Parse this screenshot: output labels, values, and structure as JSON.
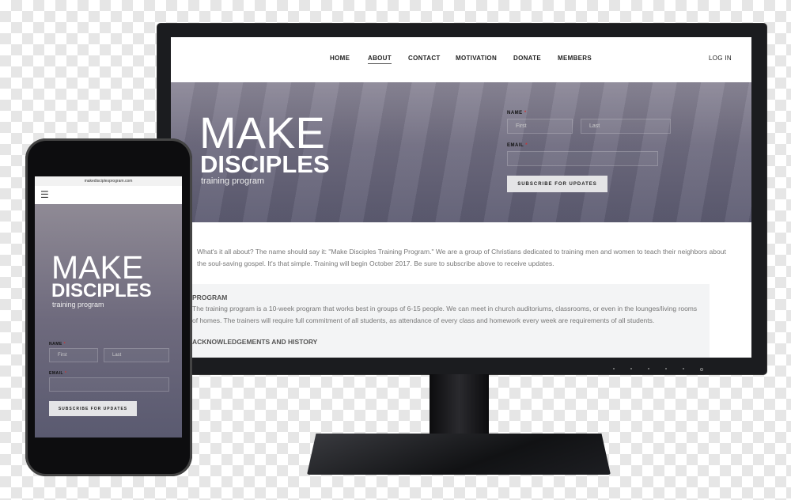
{
  "desktop": {
    "nav": {
      "items": [
        "HOME",
        "ABOUT",
        "CONTACT",
        "MOTIVATION",
        "DONATE",
        "MEMBERS"
      ],
      "active": "ABOUT",
      "login": "LOG IN"
    },
    "hero": {
      "title_line1": "MAKE",
      "title_line2": "DISCIPLES",
      "subtitle": "training program"
    },
    "form": {
      "name_label": "NAME",
      "required_mark": "*",
      "first_placeholder": "First",
      "last_placeholder": "Last",
      "email_label": "EMAIL",
      "subscribe_label": "SUBSCRIBE FOR UPDATES"
    },
    "intro": "What's it all about? The name should say it: \"Make Disciples Training Program.\" We are a group of Christians dedicated to training men and women to teach their neighbors about the soul-saving gospel. It's that simple. Training will begin October 2017. Be sure to subscribe above to receive updates.",
    "program": {
      "heading": "PROGRAM",
      "text": "The training program is a 10-week program that works best in groups of 6-15 people. We can meet in church auditoriums, classrooms, or even in the lounges/living rooms of homes. The trainers will require full commitment of all students, as attendance of every class and homework every week are requirements of all students."
    },
    "next_heading": "ACKNOWLEDGEMENTS AND HISTORY"
  },
  "mobile": {
    "url": "makedisciplesprogram.com",
    "menu_icon": "hamburger-icon",
    "hero": {
      "title_line1": "MAKE",
      "title_line2": "DISCIPLES",
      "subtitle": "training program"
    },
    "form": {
      "name_label": "NAME",
      "required_mark": "*",
      "first_placeholder": "First",
      "last_placeholder": "Last",
      "email_label": "EMAIL",
      "subscribe_label": "SUBSCRIBE FOR UPDATES"
    }
  }
}
